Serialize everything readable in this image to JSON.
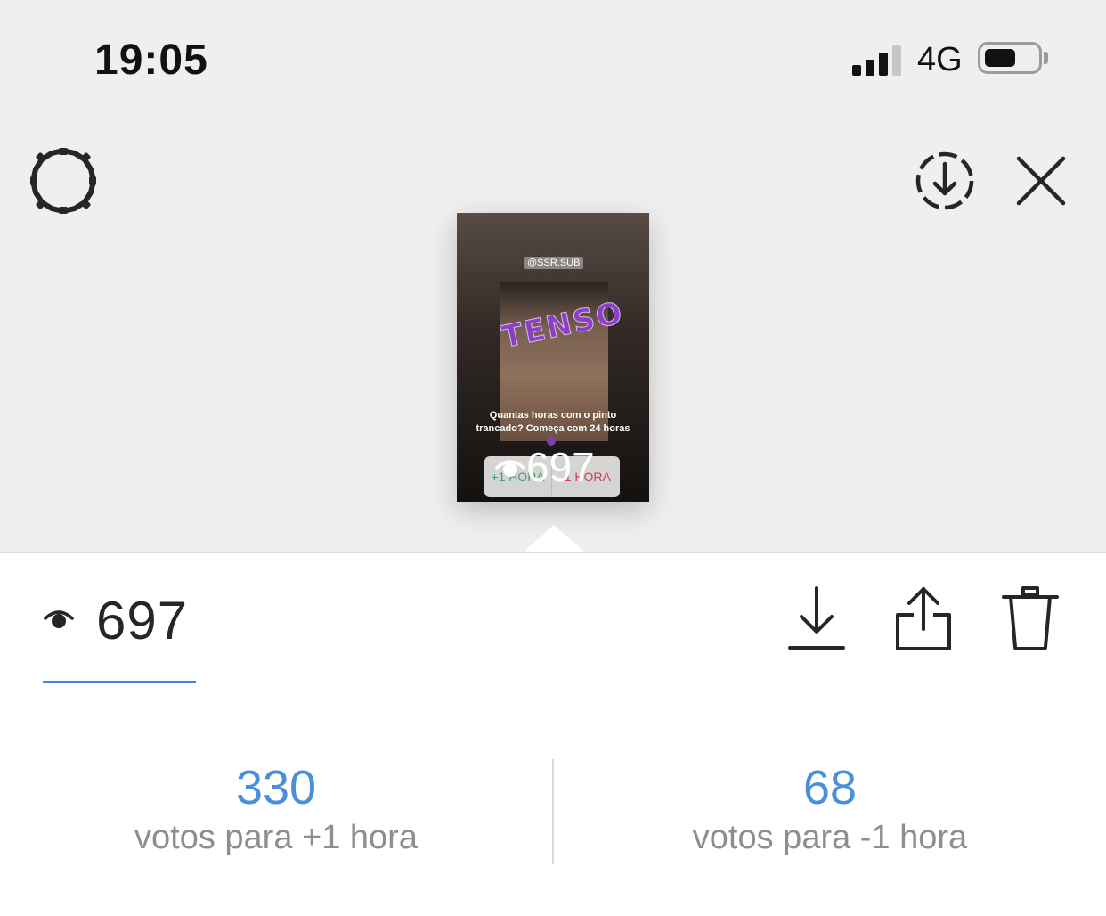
{
  "status_bar": {
    "time": "19:05",
    "network": "4G",
    "signal_bars_filled": 3,
    "signal_bars_total": 4,
    "battery_level": 0.55
  },
  "header": {
    "settings_icon": "gear-icon",
    "save_icon": "download-circle-icon",
    "close_icon": "close-icon"
  },
  "story_preview": {
    "handle": "@SSR.SUB",
    "sticker_text": "TENSO",
    "question_line1": "Quantas horas com o pinto",
    "question_line2": "trancado?  Começa com 24 horas",
    "poll_option_a": "+1 HORA",
    "poll_option_b": "-1 HORA",
    "view_count": "697"
  },
  "actions": {
    "view_icon": "eye-icon",
    "view_count": "697",
    "download_icon": "download-icon",
    "share_icon": "share-icon",
    "delete_icon": "trash-icon"
  },
  "poll_results": [
    {
      "count": "330",
      "label": "votos para +1 hora"
    },
    {
      "count": "68",
      "label": "votos para -1 hora"
    }
  ],
  "colors": {
    "accent_blue": "#4a8fdc",
    "poll_green": "#3aa564",
    "poll_red": "#d23a55"
  }
}
